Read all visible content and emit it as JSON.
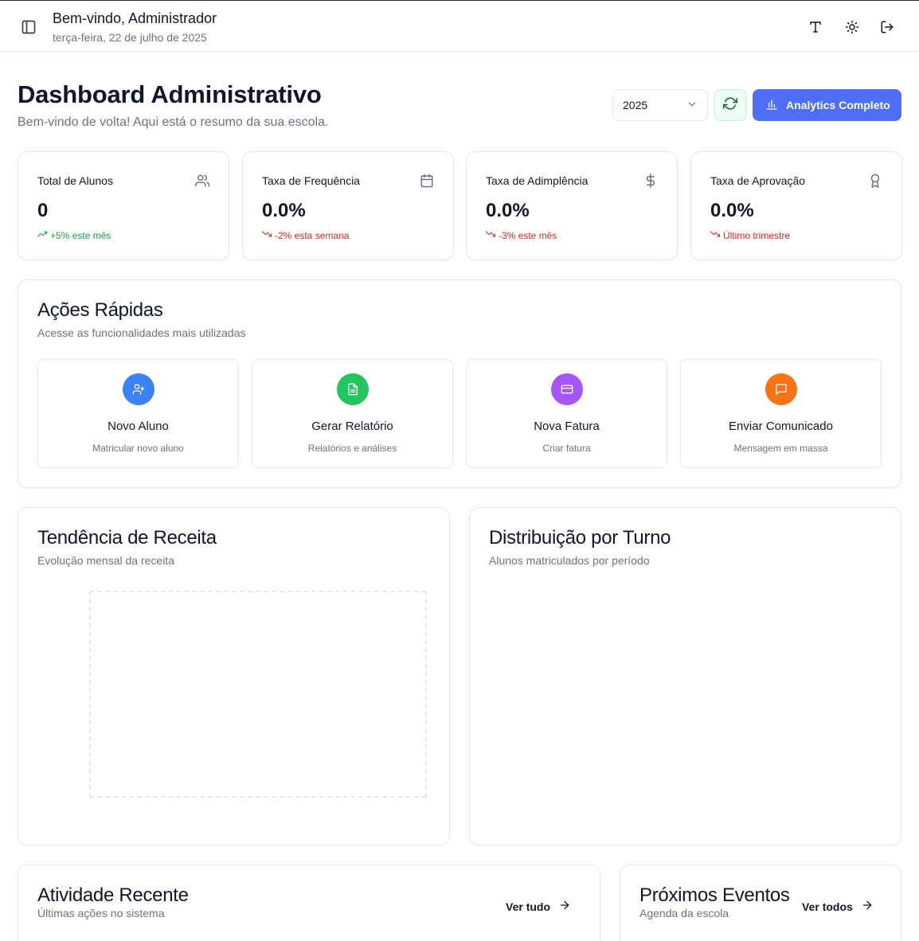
{
  "header": {
    "welcome": "Bem-vindo, Administrador",
    "date": "terça-feira, 22 de julho de 2025",
    "icons": [
      "sidebar-toggle-icon",
      "font-size-icon",
      "theme-sun-icon",
      "logout-icon"
    ]
  },
  "page": {
    "title": "Dashboard Administrativo",
    "subtitle": "Bem-vindo de volta! Aqui está o resumo da sua escola.",
    "year_value": "2025",
    "analytics_label": "Analytics Completo",
    "accent_color": "#4f6ef7"
  },
  "stats": [
    {
      "label": "Total de Alunos",
      "value": "0",
      "trend": "+5% este mês",
      "trend_dir": "up",
      "icon": "users-icon"
    },
    {
      "label": "Taxa de Frequência",
      "value": "0.0%",
      "trend": "-2% esta semana",
      "trend_dir": "down",
      "icon": "calendar-icon"
    },
    {
      "label": "Taxa de Adimplência",
      "value": "0.0%",
      "trend": "-3% este mês",
      "trend_dir": "down",
      "icon": "dollar-icon"
    },
    {
      "label": "Taxa de Aprovação",
      "value": "0.0%",
      "trend": "Último trimestre",
      "trend_dir": "down",
      "icon": "award-icon"
    }
  ],
  "quick_actions": {
    "title": "Ações Rápidas",
    "subtitle": "Acesse as funcionalidades mais utilizadas",
    "items": [
      {
        "title": "Novo Aluno",
        "subtitle": "Matricular novo aluno",
        "color": "#3b82f6",
        "icon": "user-plus-icon"
      },
      {
        "title": "Gerar Relatório",
        "subtitle": "Relatórios e análises",
        "color": "#22c55e",
        "icon": "file-text-icon"
      },
      {
        "title": "Nova Fatura",
        "subtitle": "Criar fatura",
        "color": "#a855f7",
        "icon": "credit-card-icon"
      },
      {
        "title": "Enviar Comunicado",
        "subtitle": "Mensagem em massa",
        "color": "#f97316",
        "icon": "message-icon"
      }
    ]
  },
  "revenue": {
    "title": "Tendência de Receita",
    "subtitle": "Evolução mensal da receita"
  },
  "shifts": {
    "title": "Distribuição por Turno",
    "subtitle": "Alunos matriculados por período"
  },
  "activity": {
    "title": "Atividade Recente",
    "subtitle": "Últimas ações no sistema",
    "link": "Ver tudo"
  },
  "events": {
    "title": "Próximos Eventos",
    "subtitle": "Agenda da escola",
    "link": "Ver todos"
  }
}
